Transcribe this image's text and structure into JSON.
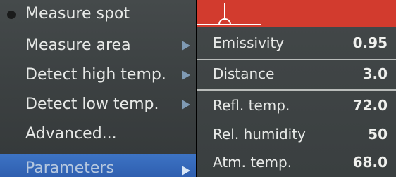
{
  "menu": {
    "items": [
      {
        "label": "Measure spot",
        "has_submenu": false,
        "active_bullet": true
      },
      {
        "label": "Measure area",
        "has_submenu": true
      },
      {
        "label": "Detect high temp.",
        "has_submenu": true
      },
      {
        "label": "Detect low temp.",
        "has_submenu": true
      },
      {
        "label": "Advanced...",
        "has_submenu": false
      },
      {
        "label": "Parameters",
        "has_submenu": true,
        "selected": true
      }
    ]
  },
  "parameters": {
    "rows": [
      {
        "label": "Emissivity",
        "value": "0.95"
      },
      {
        "label": "Distance",
        "value": "3.0"
      },
      {
        "label": "Refl. temp.",
        "value": "72.0"
      },
      {
        "label": "Rel. humidity",
        "value": "50"
      },
      {
        "label": "Atm. temp.",
        "value": "68.0"
      }
    ]
  },
  "colors": {
    "selection": "#2f5fb0",
    "alarm_bar": "#d23b2e"
  },
  "icons": {
    "bullet": "filled-circle-icon",
    "submenu": "triangle-right-icon",
    "crosshair": "measure-spot-crosshair-icon"
  }
}
